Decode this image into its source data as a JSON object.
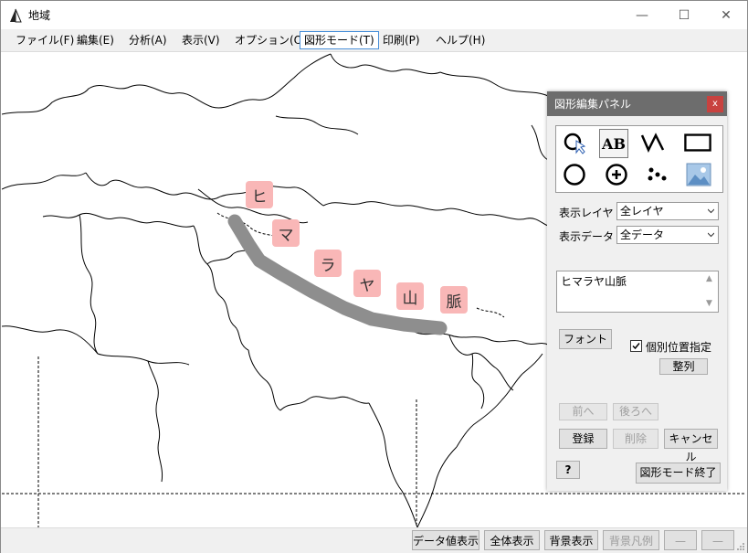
{
  "window": {
    "title": "地域",
    "controls": {
      "minimize": "—",
      "maximize": "☐",
      "close": "✕"
    }
  },
  "menu": [
    {
      "label": "ファイル(F)"
    },
    {
      "label": "編集(E)"
    },
    {
      "label": "分析(A)"
    },
    {
      "label": "表示(V)"
    },
    {
      "label": "オプション(O)"
    },
    {
      "label": "図形モード(T)",
      "active": true
    },
    {
      "label": "印刷(P)"
    },
    {
      "label": "ヘルプ(H)"
    }
  ],
  "map": {
    "line_color": "#8e8e8e",
    "label_bg": "#f9b7b7",
    "labels": [
      "ヒ",
      "マ",
      "ラ",
      "ヤ",
      "山",
      "脈"
    ]
  },
  "panel": {
    "title": "図形編集パネル",
    "close": "x",
    "tools": [
      {
        "icon": "lasso-pointer-icon"
      },
      {
        "icon": "text-ab-icon",
        "text": "AB",
        "selected": true
      },
      {
        "icon": "polyline-icon"
      },
      {
        "icon": "rectangle-icon"
      },
      {
        "icon": "circle-icon"
      },
      {
        "icon": "circle-plus-icon"
      },
      {
        "icon": "points-icon"
      },
      {
        "icon": "image-icon"
      }
    ],
    "layer_label": "表示レイヤ",
    "layer_value": "全レイヤ",
    "data_label": "表示データ",
    "data_value": "全データ",
    "text_value": "ヒマラヤ山脈",
    "font_button": "フォント",
    "individual_position_label": "個別位置指定",
    "individual_position_checked": true,
    "align_button": "整列",
    "front_button": "前へ",
    "back_button": "後ろへ",
    "register_button": "登録",
    "delete_button": "削除",
    "cancel_button": "キャンセル",
    "help_button": "?",
    "exit_button": "図形モード終了"
  },
  "statusbar": {
    "buttons": [
      {
        "label": "データ値表示",
        "enabled": true
      },
      {
        "label": "全体表示",
        "enabled": true
      },
      {
        "label": "背景表示",
        "enabled": true
      },
      {
        "label": "背景凡例",
        "enabled": false
      },
      {
        "label": "—",
        "enabled": false
      },
      {
        "label": "—",
        "enabled": false
      }
    ]
  }
}
